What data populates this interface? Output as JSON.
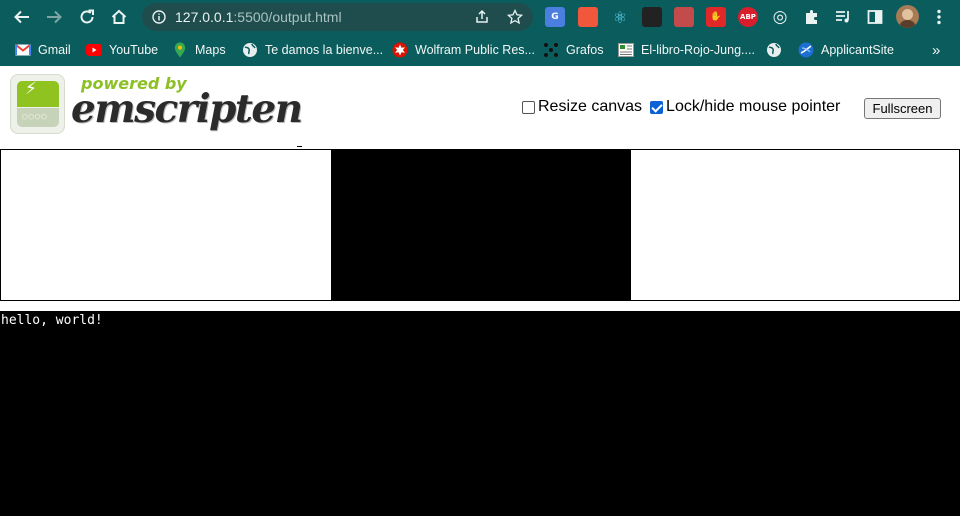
{
  "browser": {
    "url_host": "127.0.0.1",
    "url_rest": ":5500/output.html",
    "bookmarks": [
      {
        "label": "Gmail",
        "icon": "gmail-icon"
      },
      {
        "label": "YouTube",
        "icon": "youtube-icon"
      },
      {
        "label": "Maps",
        "icon": "maps-icon"
      },
      {
        "label": "Te damos la bienve...",
        "icon": "globe-icon"
      },
      {
        "label": "Wolfram Public Res...",
        "icon": "wolfram-icon"
      },
      {
        "label": "Grafos",
        "icon": "grafos-icon"
      },
      {
        "label": "El-libro-Rojo-Jung....",
        "icon": "page-icon"
      },
      {
        "label": "ApplicantSite",
        "icon": "applicantsite-icon"
      }
    ],
    "bookmarks_overflow": "»",
    "extensions": [
      {
        "name": "google-translate-icon",
        "text": "G",
        "color": "#4a7fe0"
      },
      {
        "name": "extension-flag-icon",
        "text": "",
        "color": "#f0573b"
      },
      {
        "name": "react-devtools-icon",
        "text": "⚛",
        "color": "#61dafb"
      },
      {
        "name": "extension-dark-icon",
        "text": "",
        "color": "#222222"
      },
      {
        "name": "extension-pen-icon",
        "text": "",
        "color": "#c44b4b"
      },
      {
        "name": "hand-stop-icon",
        "text": "✋",
        "color": "#e02828"
      },
      {
        "name": "adblock-plus-icon",
        "text": "ABP",
        "color": "#d81e2d"
      },
      {
        "name": "target-icon",
        "text": "◎",
        "color": "#0b5c5c"
      }
    ]
  },
  "page": {
    "logo": {
      "powered_by": "powered by",
      "brand": "emscripten"
    },
    "controls": {
      "resize_canvas_label": "Resize canvas",
      "resize_canvas_checked": false,
      "lock_pointer_label": "Lock/hide mouse pointer",
      "lock_pointer_checked": true,
      "fullscreen_label": "Fullscreen"
    },
    "output_text": "hello, world!"
  }
}
